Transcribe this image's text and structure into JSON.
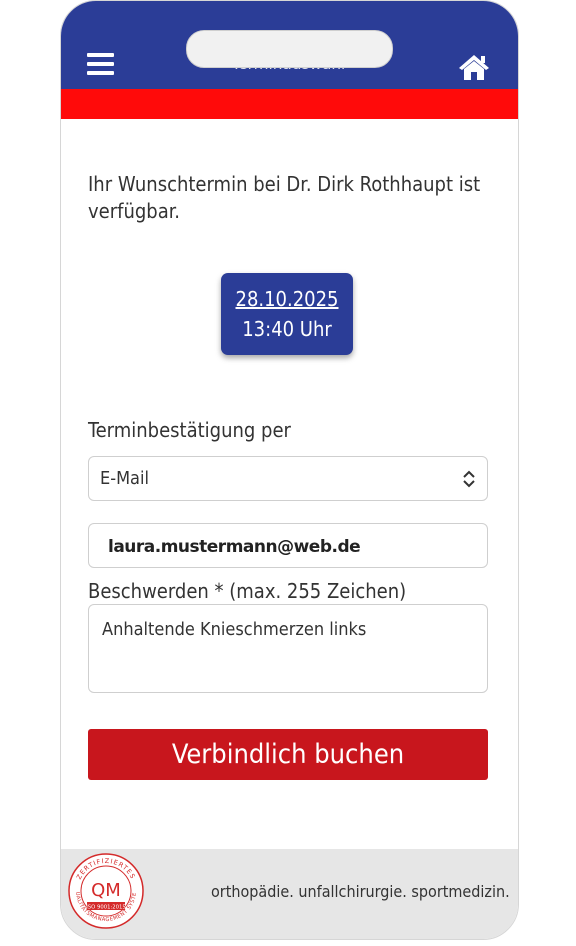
{
  "header": {
    "title": "Terminauswahl",
    "menu_icon": "menu-icon",
    "home_icon": "home-icon"
  },
  "intro": {
    "text": "Ihr Wunschtermin bei Dr. Dirk Rothhaupt ist verfügbar."
  },
  "appointment": {
    "date": "28.10.2025",
    "time": "13:40 Uhr"
  },
  "confirmation": {
    "label": "Terminbestätigung per",
    "selected": "E-Mail"
  },
  "email": {
    "value": "laura.mustermann@web.de"
  },
  "complaints": {
    "label": "Beschwerden * (max. 255 Zeichen)",
    "value": "Anhaltende Knieschmerzen links"
  },
  "actions": {
    "book_label": "Verbindlich buchen"
  },
  "footer": {
    "tagline": "orthopädie. unfallchirurgie. sportmedizin.",
    "seal_top": "ZERTIFIZIERTES",
    "seal_center": "QM",
    "seal_iso": "ISO 9001:2015",
    "seal_bottom": "QUALITÄTSMANAGEMENT SYSTEM"
  },
  "colors": {
    "primary_blue": "#2b3d97",
    "accent_red": "#ff0a0a",
    "button_red": "#c8161d"
  }
}
